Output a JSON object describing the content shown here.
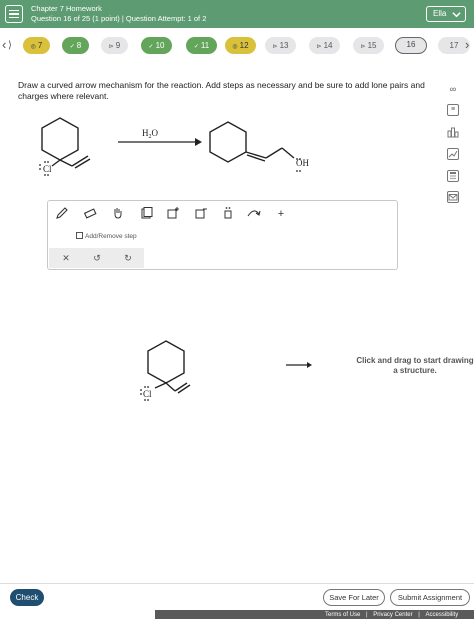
{
  "header": {
    "title": "Chapter 7 Homework",
    "subtitle": "Question 16 of 25 (1 point)  |  Question Attempt: 1 of 2",
    "user": "Ella"
  },
  "question_nav": {
    "items": [
      {
        "label": "7",
        "status": "gold"
      },
      {
        "label": "8",
        "status": "green"
      },
      {
        "label": "9",
        "status": "grey"
      },
      {
        "label": "10",
        "status": "green"
      },
      {
        "label": "11",
        "status": "green"
      },
      {
        "label": "12",
        "status": "gold"
      },
      {
        "label": "13",
        "status": "grey"
      },
      {
        "label": "14",
        "status": "grey"
      },
      {
        "label": "15",
        "status": "grey"
      },
      {
        "label": "16",
        "status": "current"
      },
      {
        "label": "17",
        "status": "grey"
      }
    ]
  },
  "prompt": "Draw a curved arrow mechanism for the reaction. Add steps as necessary and be sure to add lone pairs and charges where relevant.",
  "reaction": {
    "reagent": "H2O",
    "leaving_atom": "Cl",
    "product_group": "OH"
  },
  "editor": {
    "add_step_label": "Add/Remove step"
  },
  "canvas": {
    "atom_label": "Cl",
    "hint": "Click and drag to start drawing a structure."
  },
  "footer": {
    "check_label": "Check",
    "save_label": "Save For Later",
    "submit_label": "Submit Assignment",
    "terms": "Terms of Use",
    "privacy": "Privacy Center",
    "accessibility": "Accessibility"
  },
  "colors": {
    "header_bg": "#5d9c72",
    "check_bg": "#1f4e71",
    "pill_gold": "#d9c13b",
    "pill_green": "#63a65b"
  }
}
